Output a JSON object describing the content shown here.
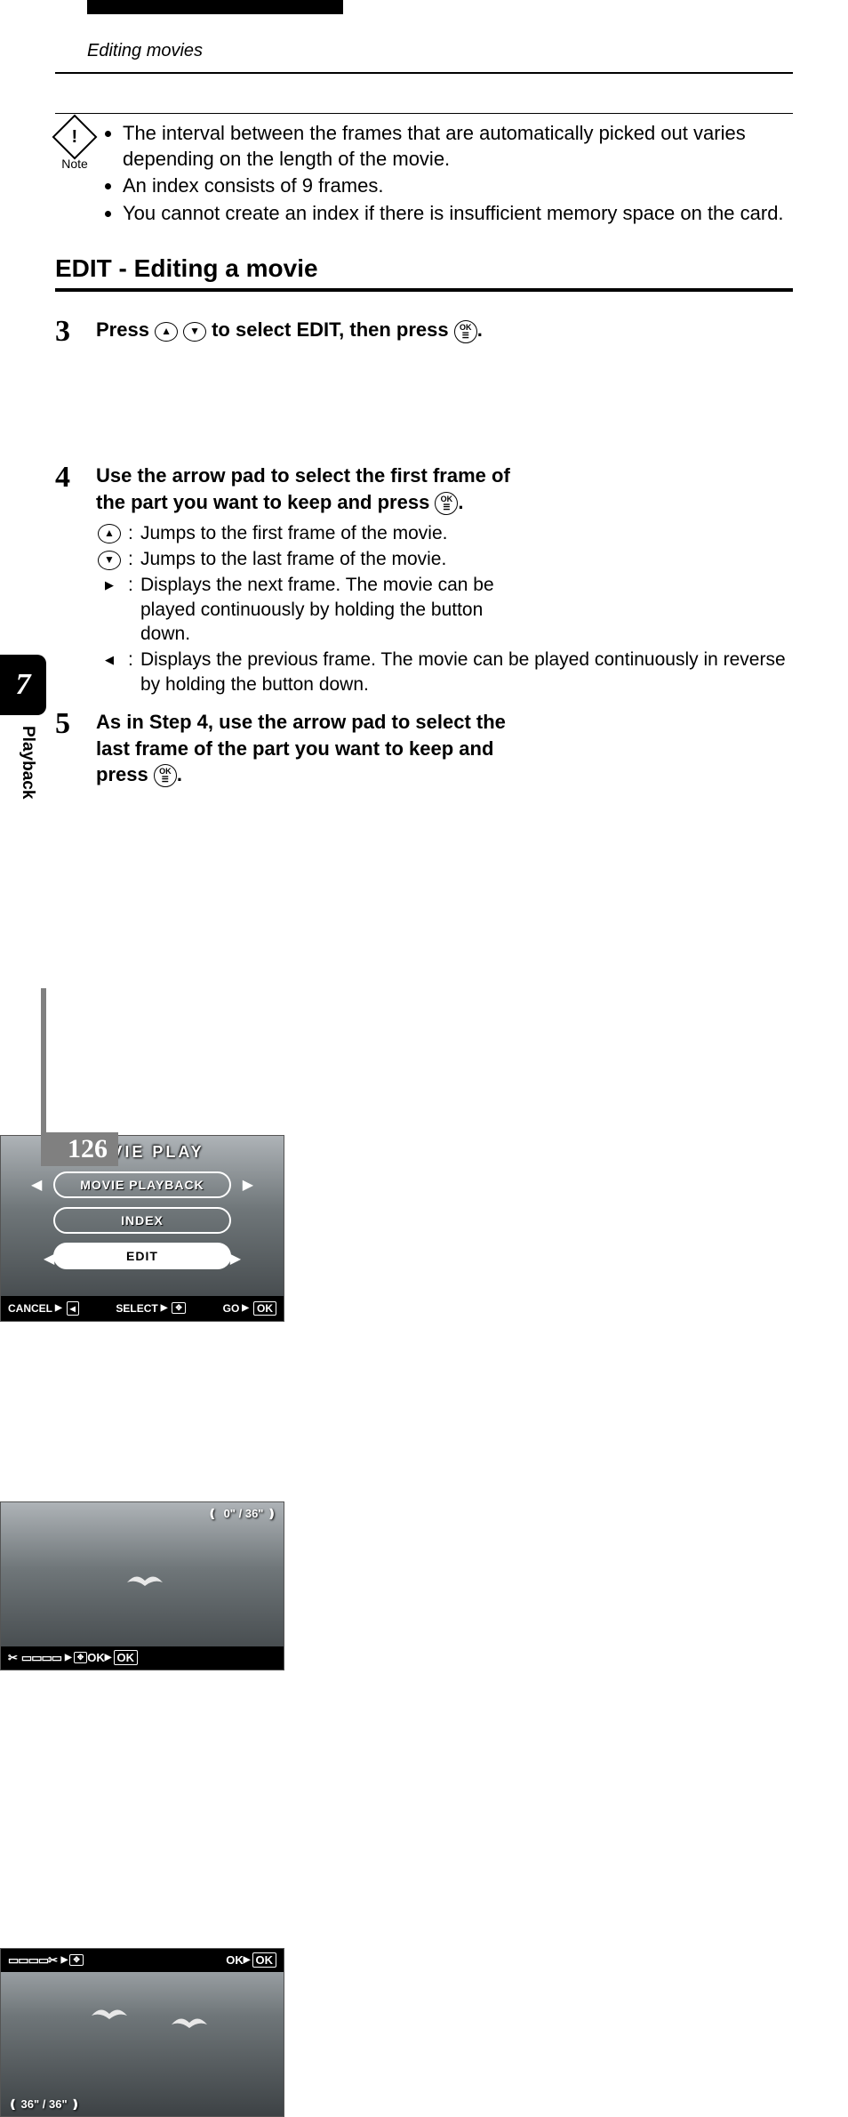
{
  "header": {
    "section": "Editing movies"
  },
  "note": {
    "icon_char": "!",
    "label": "Note",
    "items": [
      "The interval between the frames that are automatically picked out varies depending on the length of the movie.",
      "An index consists of 9 frames.",
      "You cannot create an index if there is insufficient memory space on the card."
    ]
  },
  "edit_title": "EDIT - Editing a movie",
  "steps": {
    "s3": {
      "num": "3",
      "before": "Press ",
      "after": " to select EDIT, then press ",
      "period": "."
    },
    "s4": {
      "num": "4",
      "main_pre": "Use the arrow pad to select the first frame of the part you want to keep and press ",
      "main_post": ".",
      "sub": [
        {
          "key_icon": "up",
          "text": "Jumps to the first frame of the movie."
        },
        {
          "key_icon": "down",
          "text": "Jumps to the last frame of the movie."
        },
        {
          "key_icon": "right",
          "text": "Displays the next frame. The movie can be played continuously by holding the button down."
        },
        {
          "key_icon": "left",
          "text": "Displays the previous frame. The movie can be played continuously in reverse by holding the button down."
        }
      ]
    },
    "s5": {
      "num": "5",
      "main_pre": "As in Step 4, use the arrow pad to select the last frame of the part you want to keep and press ",
      "main_post": "."
    }
  },
  "screens": {
    "s1": {
      "title": "MOVIE PLAY",
      "items": [
        "MOVIE PLAYBACK",
        "INDEX",
        "EDIT"
      ],
      "selected": "EDIT",
      "footer": {
        "cancel": "CANCEL",
        "select": "SELECT",
        "go": "GO",
        "ok": "OK"
      }
    },
    "s2": {
      "counter_left": "0\"",
      "counter_sep": "/",
      "counter_right": "36\"",
      "ok": "OK"
    },
    "s3": {
      "counter_left": "36\"",
      "counter_sep": "/",
      "counter_right": "36\"",
      "ok": "OK"
    }
  },
  "sidebar": {
    "chapter": "7",
    "label": "Playback"
  },
  "page_number": "126",
  "ok_label": "OK"
}
